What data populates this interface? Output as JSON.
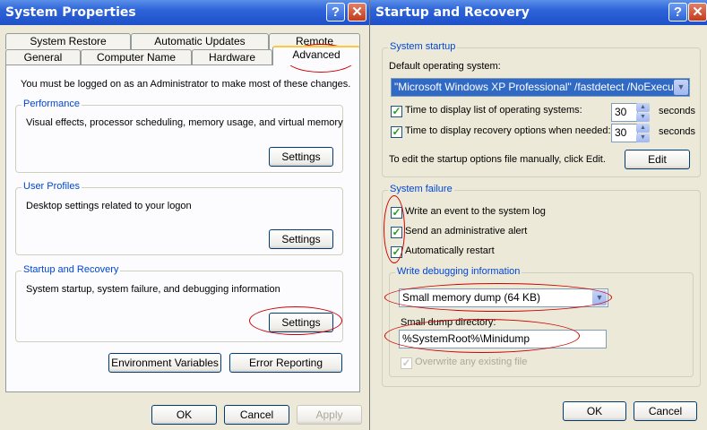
{
  "left": {
    "title": "System Properties",
    "help_glyph": "?",
    "close_glyph": "✕",
    "tabs_row1": [
      "System Restore",
      "Automatic Updates",
      "Remote"
    ],
    "tabs_row2": [
      "General",
      "Computer Name",
      "Hardware",
      "Advanced"
    ],
    "admin_note": "You must be logged on as an Administrator to make most of these changes.",
    "performance": {
      "title": "Performance",
      "desc": "Visual effects, processor scheduling, memory usage, and virtual memory",
      "button": "Settings"
    },
    "user_profiles": {
      "title": "User Profiles",
      "desc": "Desktop settings related to your logon",
      "button": "Settings"
    },
    "startup_recovery": {
      "title": "Startup and Recovery",
      "desc": "System startup, system failure, and debugging information",
      "button": "Settings"
    },
    "env_button": "Environment Variables",
    "error_button": "Error Reporting",
    "ok": "OK",
    "cancel": "Cancel",
    "apply": "Apply"
  },
  "right": {
    "title": "Startup and Recovery",
    "help_glyph": "?",
    "close_glyph": "✕",
    "system_startup": {
      "title": "System startup",
      "default_os_label": "Default operating system:",
      "default_os_value": "\"Microsoft Windows XP Professional\" /fastdetect /NoExecute=Op",
      "display_list_label": "Time to display list of operating systems:",
      "display_list_value": "30",
      "display_recovery_label": "Time to display recovery options when needed:",
      "display_recovery_value": "30",
      "seconds": "seconds",
      "edit_note": "To edit the startup options file manually, click Edit.",
      "edit_button": "Edit"
    },
    "system_failure": {
      "title": "System failure",
      "write_event": "Write an event to the system log",
      "send_alert": "Send an administrative alert",
      "auto_restart": "Automatically restart",
      "debug_title": "Write debugging information",
      "dump_type": "Small memory dump (64 KB)",
      "dump_dir_label": "Small dump directory:",
      "dump_dir_value": "%SystemRoot%\\Minidump",
      "overwrite": "Overwrite any existing file"
    },
    "ok": "OK",
    "cancel": "Cancel"
  },
  "checkmark": "✓",
  "arrow_down": "▼",
  "arrow_up": "▲"
}
